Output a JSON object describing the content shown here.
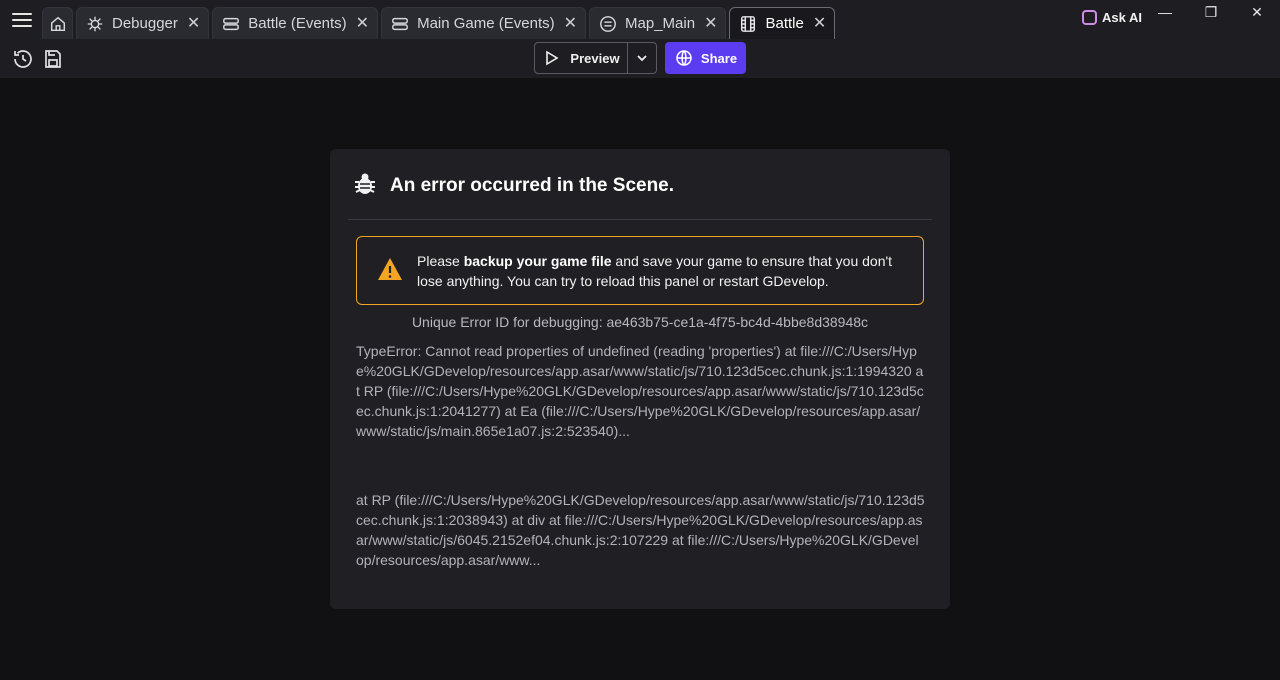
{
  "tabs": [
    {
      "label": "",
      "icon": "home-icon"
    },
    {
      "label": "Debugger",
      "icon": "bug-nodes-icon"
    },
    {
      "label": "Battle (Events)",
      "icon": "events-list-icon"
    },
    {
      "label": "Main Game (Events)",
      "icon": "events-list-icon"
    },
    {
      "label": "Map_Main",
      "icon": "external-events-icon"
    },
    {
      "label": "Battle",
      "icon": "film-scene-icon"
    }
  ],
  "active_tab": "Battle",
  "ask_ai": {
    "label": "Ask AI"
  },
  "window_controls": {
    "minimize": "—",
    "restore": "❐",
    "close": "✕"
  },
  "toolbar": {
    "preview_label": "Preview",
    "share_label": "Share"
  },
  "colors": {
    "accent": "#5b3cf0",
    "warning": "#f5a524",
    "panel": "#1f1f24"
  },
  "error": {
    "title": "An error occurred in the Scene.",
    "warning_prefix": "Please ",
    "warning_bold": "backup your game file",
    "warning_suffix": " and save your game to ensure that you don't lose anything. You can try to reload this panel or restart GDevelop.",
    "error_id": "Unique Error ID for debugging: ae463b75-ce1a-4f75-bc4d-4bbe8d38948c",
    "stack_1": "TypeError: Cannot read properties of undefined (reading 'properties') at file:///C:/Users/Hype%20GLK/GDevelop/resources/app.asar/www/static/js/710.123d5cec.chunk.js:1:1994320 at RP (file:///C:/Users/Hype%20GLK/GDevelop/resources/app.asar/www/static/js/710.123d5cec.chunk.js:1:2041277) at Ea (file:///C:/Users/Hype%20GLK/GDevelop/resources/app.asar/www/static/js/main.865e1a07.js:2:523540)...",
    "stack_2": "at RP (file:///C:/Users/Hype%20GLK/GDevelop/resources/app.asar/www/static/js/710.123d5cec.chunk.js:1:2038943) at div at file:///C:/Users/Hype%20GLK/GDevelop/resources/app.asar/www/static/js/6045.2152ef04.chunk.js:2:107229 at file:///C:/Users/Hype%20GLK/GDevelop/resources/app.asar/www..."
  }
}
